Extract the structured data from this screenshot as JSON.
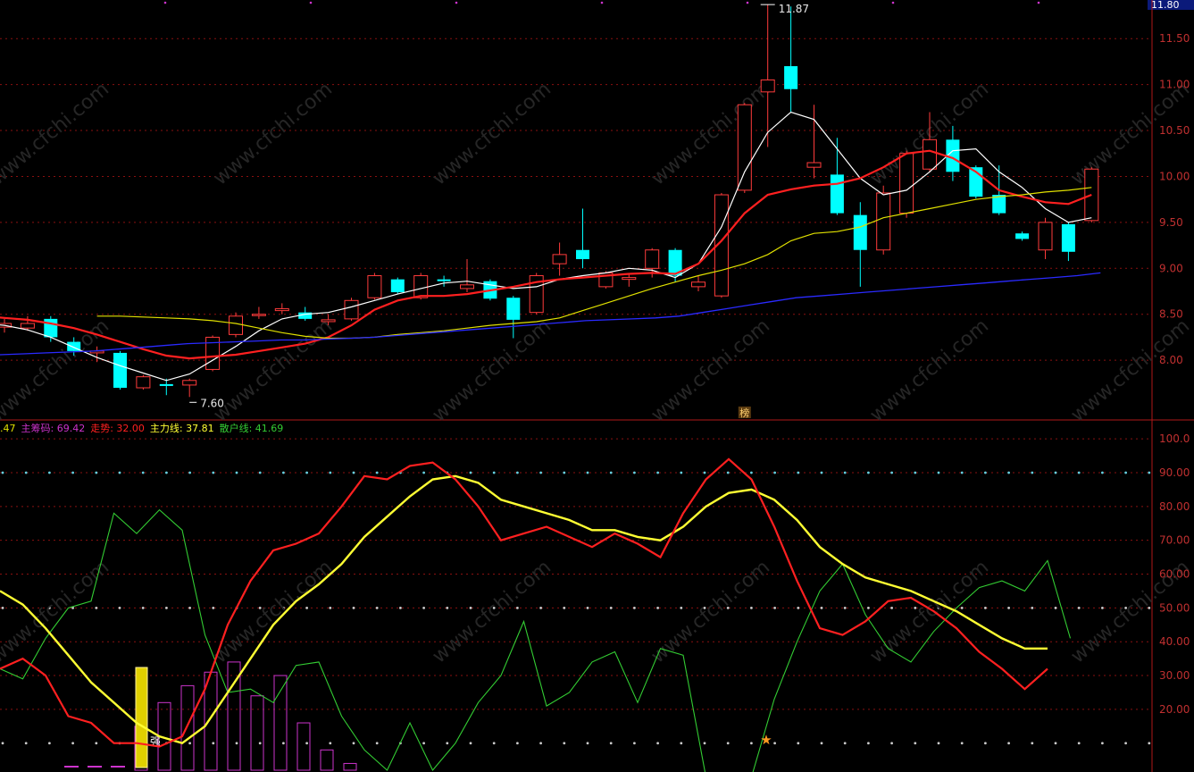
{
  "colors": {
    "up": "#ff3b3b",
    "down": "#00ffff",
    "ma5": "#ffffff",
    "ma10": "#ff2020",
    "ma20": "#e0e000",
    "ma60": "#2a2aff",
    "grid": "#8a1010",
    "axis_text": "#c03030",
    "main_chip": "#cc33cc",
    "trend": "#ff2020",
    "main_force": "#ffff33",
    "retail": "#33cc33"
  },
  "price_axis": {
    "labels": [
      "11.50",
      "11.00",
      "10.50",
      "10.00",
      "9.50",
      "9.00",
      "8.50",
      "8.00"
    ],
    "current_price": "11.80",
    "high_label": "11.87",
    "low_label": "7.60",
    "list_badge": "榜"
  },
  "indicator_axis": {
    "labels": [
      "100.0",
      "90.00",
      "80.00",
      "70.00",
      "60.00",
      "50.00",
      "40.00",
      "30.00",
      "20.00"
    ]
  },
  "legend": {
    "lead": ".47",
    "main_chip": "主筹码: 69.42",
    "trend": "走势: 32.00",
    "main_force": "主力线: 37.81",
    "retail": "散户线: 41.69"
  },
  "markers": {
    "volume_tag": "强"
  },
  "chart_data": [
    {
      "type": "candlestick",
      "ylim": [
        7.35,
        11.92
      ],
      "candles": [
        {
          "o": 8.36,
          "c": 8.4,
          "h": 8.45,
          "l": 8.3
        },
        {
          "o": 8.35,
          "c": 8.4,
          "h": 8.48,
          "l": 8.32
        },
        {
          "o": 8.45,
          "c": 8.25,
          "h": 8.48,
          "l": 8.2
        },
        {
          "o": 8.2,
          "c": 8.1,
          "h": 8.25,
          "l": 8.05
        },
        {
          "o": 8.08,
          "c": 8.1,
          "h": 8.15,
          "l": 7.98
        },
        {
          "o": 8.08,
          "c": 7.7,
          "h": 8.1,
          "l": 7.68
        },
        {
          "o": 7.7,
          "c": 7.82,
          "h": 7.84,
          "l": 7.68
        },
        {
          "o": 7.74,
          "c": 7.72,
          "h": 7.8,
          "l": 7.62
        },
        {
          "o": 7.73,
          "c": 7.78,
          "h": 7.8,
          "l": 7.6
        },
        {
          "o": 7.9,
          "c": 8.25,
          "h": 8.27,
          "l": 7.88
        },
        {
          "o": 8.28,
          "c": 8.48,
          "h": 8.52,
          "l": 8.25
        },
        {
          "o": 8.5,
          "c": 8.5,
          "h": 8.58,
          "l": 8.45
        },
        {
          "o": 8.54,
          "c": 8.56,
          "h": 8.62,
          "l": 8.5
        },
        {
          "o": 8.52,
          "c": 8.45,
          "h": 8.58,
          "l": 8.43
        },
        {
          "o": 8.42,
          "c": 8.44,
          "h": 8.5,
          "l": 8.38
        },
        {
          "o": 8.45,
          "c": 8.65,
          "h": 8.68,
          "l": 8.43
        },
        {
          "o": 8.68,
          "c": 8.92,
          "h": 8.95,
          "l": 8.66
        },
        {
          "o": 8.88,
          "c": 8.74,
          "h": 8.9,
          "l": 8.72
        },
        {
          "o": 8.68,
          "c": 8.92,
          "h": 8.95,
          "l": 8.66
        },
        {
          "o": 8.88,
          "c": 8.86,
          "h": 8.92,
          "l": 8.8
        },
        {
          "o": 8.78,
          "c": 8.82,
          "h": 9.1,
          "l": 8.74
        },
        {
          "o": 8.86,
          "c": 8.67,
          "h": 8.88,
          "l": 8.65
        },
        {
          "o": 8.68,
          "c": 8.44,
          "h": 8.7,
          "l": 8.24
        },
        {
          "o": 8.52,
          "c": 8.92,
          "h": 8.95,
          "l": 8.5
        },
        {
          "o": 9.05,
          "c": 9.15,
          "h": 9.28,
          "l": 8.92
        },
        {
          "o": 9.2,
          "c": 9.1,
          "h": 9.65,
          "l": 9.0
        },
        {
          "o": 8.8,
          "c": 8.95,
          "h": 8.97,
          "l": 8.78
        },
        {
          "o": 8.88,
          "c": 8.9,
          "h": 8.94,
          "l": 8.8
        },
        {
          "o": 9.0,
          "c": 9.2,
          "h": 9.22,
          "l": 8.9
        },
        {
          "o": 9.2,
          "c": 8.92,
          "h": 9.22,
          "l": 8.85
        },
        {
          "o": 8.8,
          "c": 8.85,
          "h": 8.92,
          "l": 8.75
        },
        {
          "o": 8.7,
          "c": 9.8,
          "h": 9.82,
          "l": 8.68
        },
        {
          "o": 9.85,
          "c": 10.78,
          "h": 10.8,
          "l": 9.82
        },
        {
          "o": 10.92,
          "c": 11.05,
          "h": 11.87,
          "l": 10.32
        },
        {
          "o": 11.2,
          "c": 10.95,
          "h": 11.85,
          "l": 10.7
        },
        {
          "o": 10.1,
          "c": 10.15,
          "h": 10.78,
          "l": 9.98
        },
        {
          "o": 10.02,
          "c": 9.6,
          "h": 10.42,
          "l": 9.58
        },
        {
          "o": 9.58,
          "c": 9.2,
          "h": 9.72,
          "l": 8.8
        },
        {
          "o": 9.2,
          "c": 9.82,
          "h": 9.9,
          "l": 9.15
        },
        {
          "o": 9.6,
          "c": 10.25,
          "h": 10.28,
          "l": 9.55
        },
        {
          "o": 10.08,
          "c": 10.4,
          "h": 10.7,
          "l": 10.05
        },
        {
          "o": 10.4,
          "c": 10.05,
          "h": 10.55,
          "l": 9.95
        },
        {
          "o": 10.1,
          "c": 9.78,
          "h": 10.12,
          "l": 9.76
        },
        {
          "o": 9.8,
          "c": 9.6,
          "h": 10.12,
          "l": 9.58
        },
        {
          "o": 9.38,
          "c": 9.32,
          "h": 9.4,
          "l": 9.3
        },
        {
          "o": 9.2,
          "c": 9.5,
          "h": 9.55,
          "l": 9.1
        },
        {
          "o": 9.48,
          "c": 9.18,
          "h": 9.5,
          "l": 9.08
        },
        {
          "o": 9.52,
          "c": 10.08,
          "h": 10.1,
          "l": 9.5
        }
      ],
      "ma_lines": [
        {
          "name": "MA5",
          "values": [
            8.4,
            8.38,
            8.33,
            8.25,
            8.14,
            8.03,
            7.94,
            7.86,
            7.78,
            7.85,
            8.0,
            8.15,
            8.32,
            8.45,
            8.5,
            8.52,
            8.58,
            8.65,
            8.72,
            8.78,
            8.84,
            8.86,
            8.82,
            8.78,
            8.8,
            8.88,
            8.92,
            8.95,
            9.0,
            8.98,
            8.9,
            9.05,
            9.45,
            10.05,
            10.48,
            10.7,
            10.62,
            10.3,
            9.98,
            9.8,
            9.85,
            10.05,
            10.28,
            10.3,
            10.05,
            9.88,
            9.65,
            9.5,
            9.55
          ]
        },
        {
          "name": "MA10",
          "values": [
            8.48,
            8.46,
            8.44,
            8.4,
            8.35,
            8.28,
            8.2,
            8.12,
            8.05,
            8.02,
            8.04,
            8.06,
            8.1,
            8.14,
            8.18,
            8.25,
            8.38,
            8.55,
            8.65,
            8.7,
            8.7,
            8.72,
            8.76,
            8.8,
            8.85,
            8.88,
            8.9,
            8.92,
            8.94,
            8.95,
            8.94,
            9.05,
            9.3,
            9.6,
            9.8,
            9.86,
            9.9,
            9.92,
            9.98,
            10.1,
            10.25,
            10.28,
            10.2,
            10.05,
            9.85,
            9.78,
            9.72,
            9.7,
            9.8
          ]
        },
        {
          "name": "MA20",
          "values": [
            8.48,
            8.48,
            8.47,
            8.46,
            8.45,
            8.43,
            8.4,
            8.35,
            8.3,
            8.26,
            8.24,
            8.24,
            8.25,
            8.28,
            8.3,
            8.32,
            8.35,
            8.38,
            8.4,
            8.42,
            8.46,
            8.54,
            8.62,
            8.7,
            8.78,
            8.85,
            8.92,
            8.98,
            9.05,
            9.15,
            9.3,
            9.38,
            9.4,
            9.45,
            9.55,
            9.6,
            9.65,
            9.7,
            9.75,
            9.78,
            9.8,
            9.83,
            9.85,
            9.88
          ]
        },
        {
          "name": "MA60",
          "values": [
            8.06,
            8.07,
            8.08,
            8.09,
            8.1,
            8.12,
            8.14,
            8.16,
            8.18,
            8.19,
            8.2,
            8.21,
            8.22,
            8.22,
            8.23,
            8.24,
            8.25,
            8.27,
            8.29,
            8.31,
            8.33,
            8.35,
            8.37,
            8.39,
            8.41,
            8.43,
            8.44,
            8.45,
            8.46,
            8.48,
            8.52,
            8.56,
            8.6,
            8.64,
            8.68,
            8.7,
            8.72,
            8.74,
            8.76,
            8.78,
            8.8,
            8.82,
            8.84,
            8.86,
            8.88,
            8.9,
            8.92,
            8.95
          ]
        }
      ]
    },
    {
      "type": "line",
      "ylim": [
        2,
        104
      ],
      "series": [
        {
          "name": "走势",
          "values": [
            32,
            35,
            30,
            18,
            16,
            10,
            10,
            9,
            12,
            26,
            45,
            58,
            67,
            69,
            72,
            80,
            89,
            88,
            92,
            93,
            88,
            80,
            70,
            72,
            74,
            71,
            68,
            72,
            69,
            65,
            78,
            88,
            94,
            88,
            74,
            58,
            44,
            42,
            46,
            52,
            53,
            49,
            44,
            37,
            32,
            26,
            32
          ]
        },
        {
          "name": "主力线",
          "values": [
            55,
            51,
            44,
            36,
            28,
            22,
            16,
            12,
            10,
            15,
            25,
            35,
            45,
            52,
            57,
            63,
            71,
            77,
            83,
            88,
            89,
            87,
            82,
            80,
            78,
            76,
            73,
            73,
            71,
            70,
            74,
            80,
            84,
            85,
            82,
            76,
            68,
            63,
            59,
            57,
            55,
            52,
            49,
            45,
            41,
            38,
            38
          ]
        },
        {
          "name": "散户线",
          "values": [
            32,
            29,
            41,
            50,
            52,
            78,
            72,
            79,
            73,
            42,
            25,
            26,
            22,
            33,
            34,
            18,
            8,
            2,
            16,
            2,
            10,
            22,
            30,
            46,
            21,
            25,
            34,
            37,
            22,
            38,
            36,
            0,
            0,
            0,
            23,
            40,
            55,
            63,
            48,
            38,
            34,
            43,
            50,
            56,
            58,
            55,
            64,
            41
          ]
        },
        {
          "name": "主筹码",
          "values": [
            0,
            0,
            0,
            15,
            22,
            27,
            31,
            34,
            24,
            30,
            16,
            8,
            4,
            2,
            1,
            1,
            1,
            1
          ]
        }
      ]
    }
  ]
}
